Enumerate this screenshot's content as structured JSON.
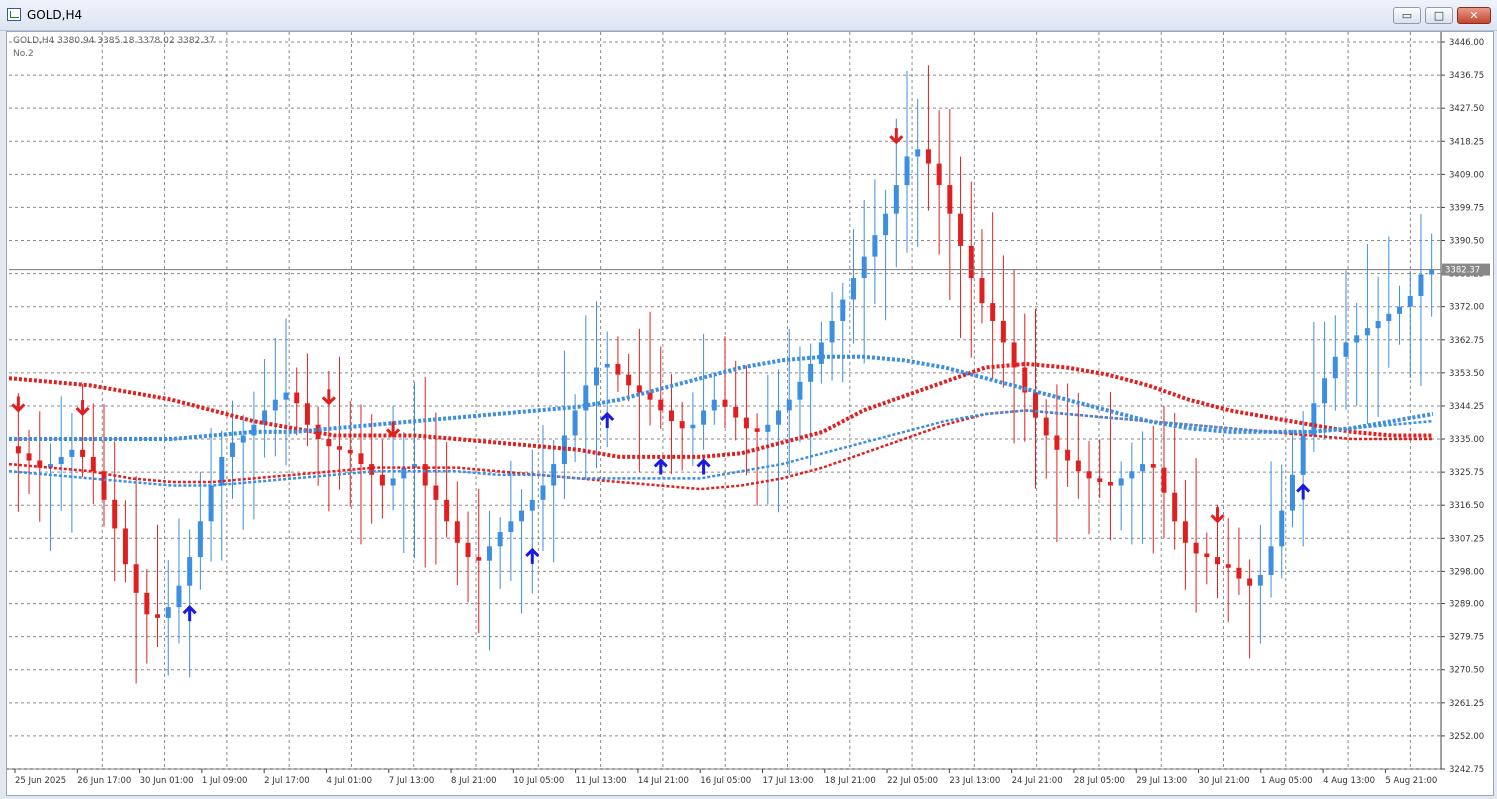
{
  "window": {
    "title": "GOLD,H4",
    "minimize_glyph": "▭",
    "maximize_glyph": "□",
    "close_glyph": "✕"
  },
  "chart": {
    "symbol_label": "GOLD,H4  3380.94 3385.18 3378.02 3382.37",
    "indicator_label": "No.2",
    "current_price_label": "3382.37"
  },
  "chart_data": {
    "type": "candlestick",
    "timeframe": "H4",
    "symbol": "GOLD",
    "ylim": [
      3242.75,
      3446.0
    ],
    "grid": true,
    "y_ticks": [
      "3446.00",
      "3436.75",
      "3427.50",
      "3418.25",
      "3409.00",
      "3399.75",
      "3390.50",
      "3381.25",
      "3372.00",
      "3362.75",
      "3353.50",
      "3344.25",
      "3335.00",
      "3325.75",
      "3316.50",
      "3307.25",
      "3298.00",
      "3289.00",
      "3279.75",
      "3270.50",
      "3261.25",
      "3252.00",
      "3242.75"
    ],
    "x_ticks": [
      "25 Jun 2025",
      "26 Jun 17:00",
      "30 Jun 01:00",
      "1 Jul 09:00",
      "2 Jul 17:00",
      "4 Jul 01:00",
      "7 Jul 13:00",
      "8 Jul 21:00",
      "10 Jul 05:00",
      "11 Jul 13:00",
      "14 Jul 21:00",
      "16 Jul 05:00",
      "17 Jul 13:00",
      "18 Jul 21:00",
      "22 Jul 05:00",
      "23 Jul 13:00",
      "24 Jul 21:00",
      "28 Jul 05:00",
      "29 Jul 13:00",
      "30 Jul 21:00",
      "1 Aug 05:00",
      "4 Aug 13:00",
      "5 Aug 21:00"
    ],
    "close_path": [
      3331,
      3329,
      3327,
      3328,
      3330,
      3332,
      3330,
      3326,
      3318,
      3310,
      3300,
      3292,
      3286,
      3285,
      3288,
      3294,
      3302,
      3312,
      3322,
      3330,
      3334,
      3336,
      3339,
      3343,
      3346,
      3348,
      3345,
      3339,
      3335,
      3333,
      3332,
      3331,
      3328,
      3325,
      3322,
      3324,
      3327,
      3328,
      3322,
      3318,
      3312,
      3306,
      3302,
      3301,
      3305,
      3309,
      3312,
      3315,
      3318,
      3322,
      3328,
      3336,
      3343,
      3350,
      3355,
      3356,
      3353,
      3350,
      3348,
      3346,
      3343,
      3340,
      3338,
      3339,
      3343,
      3346,
      3344,
      3341,
      3338,
      3337,
      3339,
      3343,
      3346,
      3351,
      3356,
      3362,
      3368,
      3374,
      3380,
      3386,
      3392,
      3398,
      3406,
      3414,
      3416,
      3412,
      3406,
      3398,
      3389,
      3380,
      3373,
      3368,
      3362,
      3355,
      3348,
      3341,
      3336,
      3332,
      3329,
      3326,
      3324,
      3323,
      3322,
      3324,
      3326,
      3328,
      3327,
      3320,
      3312,
      3306,
      3303,
      3302,
      3300,
      3299,
      3296,
      3294,
      3297,
      3305,
      3315,
      3325,
      3336,
      3345,
      3352,
      3358,
      3362,
      3364,
      3366,
      3368,
      3370,
      3372,
      3375,
      3381,
      3382.37
    ],
    "series": [
      {
        "name": "",
        "color": "#e02020",
        "values": [
          3352,
          3351,
          3350,
          3348,
          3346,
          3343,
          3340,
          3338,
          3336,
          3336,
          3336,
          3335,
          3334,
          3333,
          3332,
          3330,
          3330,
          3330,
          3331,
          3334,
          3337,
          3343,
          3347,
          3351,
          3355,
          3356,
          3355,
          3353,
          3350,
          3346,
          3343,
          3341,
          3339,
          3337,
          3336,
          3336
        ]
      },
      {
        "name": "",
        "color": "#e02020",
        "values": [
          3328,
          3327,
          3326,
          3324,
          3323,
          3323,
          3324,
          3325,
          3326,
          3327,
          3327,
          3327,
          3326,
          3325,
          3324,
          3323,
          3322,
          3321,
          3322,
          3324,
          3327,
          3331,
          3335,
          3339,
          3342,
          3343,
          3342,
          3341,
          3340,
          3339,
          3338,
          3337,
          3336,
          3335,
          3335,
          3335
        ]
      },
      {
        "name": "",
        "color": "#3c8fe0",
        "values": [
          3326,
          3325,
          3324,
          3323,
          3322,
          3322,
          3323,
          3324,
          3325,
          3326,
          3326,
          3326,
          3325,
          3325,
          3324,
          3324,
          3324,
          3324,
          3326,
          3328,
          3331,
          3334,
          3337,
          3340,
          3342,
          3343,
          3342,
          3341,
          3340,
          3339,
          3338,
          3337,
          3337,
          3338,
          3339,
          3340
        ]
      },
      {
        "name": "",
        "color": "#3c8fe0",
        "values": [
          3335,
          3335,
          3335,
          3335,
          3335,
          3336,
          3337,
          3337,
          3338,
          3339,
          3340,
          3341,
          3342,
          3343,
          3344,
          3346,
          3349,
          3352,
          3355,
          3357,
          3358,
          3358,
          3357,
          3355,
          3352,
          3349,
          3346,
          3343,
          3340,
          3338,
          3337,
          3337,
          3337,
          3338,
          3340,
          3342
        ]
      }
    ],
    "sell_arrows": [
      0,
      6,
      29,
      35,
      82,
      112,
      158
    ],
    "buy_arrows": [
      16,
      48,
      55,
      60,
      64,
      120
    ]
  }
}
